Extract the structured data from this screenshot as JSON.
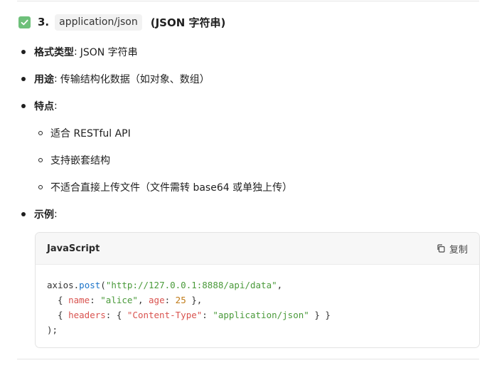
{
  "heading": {
    "number": "3.",
    "code": "application/json",
    "paren": "(JSON 字符串)"
  },
  "bullets": [
    {
      "label": "格式类型",
      "sep": ":",
      "text": "JSON 字符串"
    },
    {
      "label": "用途",
      "sep": ":",
      "text": "传输结构化数据（如对象、数组）"
    },
    {
      "label": "特点",
      "sep": ":",
      "text": ""
    }
  ],
  "features": [
    "适合 RESTful API",
    "支持嵌套结构",
    "不适合直接上传文件（文件需转 base64 或单独上传）"
  ],
  "example": {
    "label": "示例",
    "sep": ":"
  },
  "codeblock": {
    "language": "JavaScript",
    "copy_label": "复制",
    "line1": {
      "obj": "axios",
      "dot": ".",
      "fn": "post",
      "open": "(",
      "url": "\"http://127.0.0.1:8888/api/data\"",
      "end": ","
    },
    "line2": {
      "open": "  { ",
      "k1": "name",
      "c1": ": ",
      "v1": "\"alice\"",
      "comma": ", ",
      "k2": "age",
      "c2": ": ",
      "v2": "25",
      "close": " },"
    },
    "line3": {
      "open": "  { ",
      "k1": "headers",
      "c1": ": { ",
      "k2": "\"Content-Type\"",
      "c2": ": ",
      "v2": "\"application/json\"",
      "close": " } }"
    },
    "line4": ");"
  },
  "colors": {
    "check": "#6ec07a",
    "function": "#1a73c9",
    "string": "#4a9a3a",
    "key": "#d9534f",
    "number": "#c07a16"
  }
}
